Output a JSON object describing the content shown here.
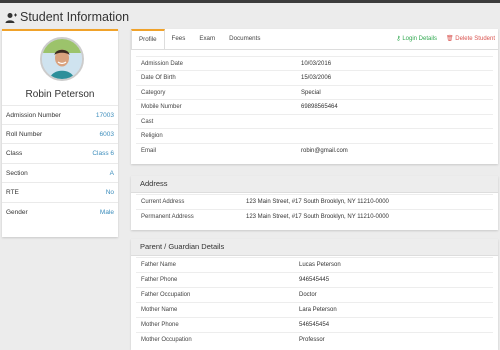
{
  "header": {
    "title": "Student Information",
    "icon": "user-add-icon"
  },
  "profile": {
    "name": "Robin Peterson",
    "fields": [
      {
        "label": "Admission Number",
        "value": "17003"
      },
      {
        "label": "Roll Number",
        "value": "6003"
      },
      {
        "label": "Class",
        "value": "Class 6"
      },
      {
        "label": "Section",
        "value": "A"
      },
      {
        "label": "RTE",
        "value": "No"
      },
      {
        "label": "Gender",
        "value": "Male"
      }
    ]
  },
  "tabs": [
    {
      "label": "Profile",
      "active": true
    },
    {
      "label": "Fees"
    },
    {
      "label": "Exam"
    },
    {
      "label": "Documents"
    }
  ],
  "actions": {
    "login": "Login Details",
    "delete": "Delete Student"
  },
  "details": [
    {
      "label": "Admission Date",
      "value": "10/03/2016"
    },
    {
      "label": "Date Of Birth",
      "value": "15/03/2006"
    },
    {
      "label": "Category",
      "value": "Special"
    },
    {
      "label": "Mobile Number",
      "value": "69898565464"
    },
    {
      "label": "Cast",
      "value": ""
    },
    {
      "label": "Religion",
      "value": ""
    },
    {
      "label": "Email",
      "value": "robin@gmail.com"
    }
  ],
  "address": {
    "title": "Address",
    "rows": [
      {
        "label": "Current Address",
        "value": "123 Main Street, #17 South Brooklyn, NY 11210-0000"
      },
      {
        "label": "Permanent Address",
        "value": "123 Main Street, #17 South Brooklyn, NY 11210-0000"
      }
    ]
  },
  "guardian": {
    "title": "Parent / Guardian Details",
    "rows": [
      {
        "label": "Father Name",
        "value": "Lucas Peterson"
      },
      {
        "label": "Father Phone",
        "value": "946545445"
      },
      {
        "label": "Father Occupation",
        "value": "Doctor"
      },
      {
        "label": "Mother Name",
        "value": "Lara Peterson"
      },
      {
        "label": "Mother Phone",
        "value": "546545454"
      },
      {
        "label": "Mother Occupation",
        "value": "Professor"
      }
    ]
  },
  "colors": {
    "accent": "#f0a22a",
    "link": "#3c8dbc",
    "success": "#2fa84f",
    "danger": "#d9534f"
  }
}
